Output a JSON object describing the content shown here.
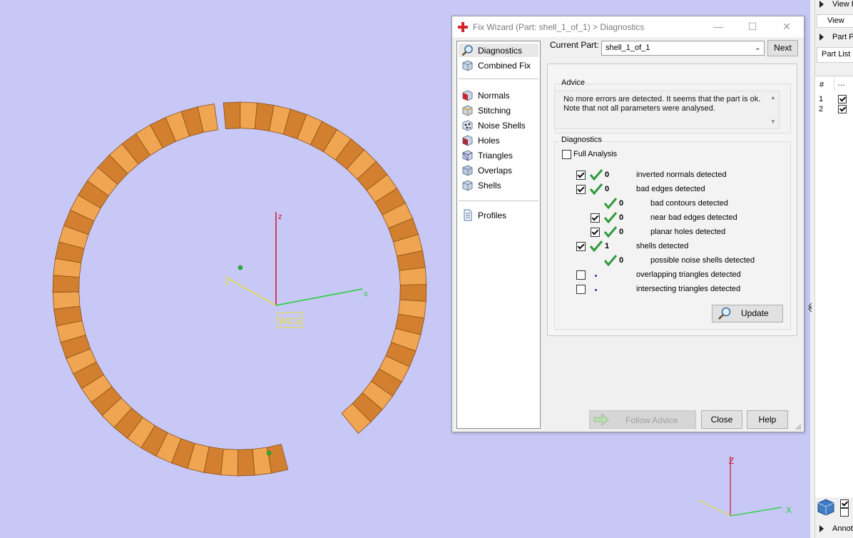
{
  "dialog": {
    "title": "Fix Wizard (Part: shell_1_of_1) > Diagnostics",
    "minimize_icon": "—",
    "maximize_icon": "☐",
    "close_icon": "✕",
    "nav": [
      {
        "label": "Diagnostics",
        "icon": "magnifier-icon",
        "selected": true
      },
      {
        "label": "Combined Fix",
        "icon": "cube-icon"
      },
      {
        "label": "Normals",
        "icon": "normals-cube-icon"
      },
      {
        "label": "Stitching",
        "icon": "stitching-cube-icon"
      },
      {
        "label": "Noise Shells",
        "icon": "noise-shells-icon"
      },
      {
        "label": "Holes",
        "icon": "holes-cube-icon"
      },
      {
        "label": "Triangles",
        "icon": "triangles-cube-icon"
      },
      {
        "label": "Overlaps",
        "icon": "overlaps-cube-icon"
      },
      {
        "label": "Shells",
        "icon": "shells-cube-icon"
      },
      {
        "label": "Profiles",
        "icon": "profile-document-icon"
      }
    ],
    "current_part_label": "Current Part:",
    "current_part_value": "shell_1_of_1",
    "next_label": "Next",
    "advice": {
      "title": "Advice",
      "text_line1": "No more errors are detected. It seems that the part is ok.",
      "text_line2": "Note that not all parameters were analysed."
    },
    "diagnostics": {
      "title": "Diagnostics",
      "full_analysis_label": "Full Analysis",
      "full_analysis_checked": false,
      "rows": [
        {
          "checked": true,
          "count": "0",
          "label": "inverted normals detected"
        },
        {
          "checked": true,
          "count": "0",
          "label": "bad edges detected"
        },
        {
          "count": "0",
          "label": "bad contours detected"
        },
        {
          "checked": true,
          "count": "0",
          "label": "near bad edges detected"
        },
        {
          "checked": true,
          "count": "0",
          "label": "planar holes detected"
        },
        {
          "checked": true,
          "count": "1",
          "label": "shells detected"
        },
        {
          "count": "0",
          "label": "possible noise shells detected"
        },
        {
          "checked": false,
          "count": "",
          "label": "overlapping triangles detected"
        },
        {
          "checked": false,
          "count": "",
          "label": "intersecting triangles detected"
        }
      ]
    },
    "update_label": "Update",
    "follow_advice_label": "Follow Advice",
    "close_label": "Close",
    "help_label": "Help"
  },
  "viewport": {
    "wcs_label": "WCS",
    "axis_z": "z",
    "axis_y": "y",
    "axis_x": "x",
    "mini_axis_z": "Z",
    "mini_axis_x": "X",
    "model_color": "#d2802f",
    "background_color": "#c8c8f7"
  },
  "right_panel": {
    "view_header": "View P",
    "view_tab": "View",
    "part_header": "Part P",
    "part_list_tab": "Part List",
    "col_hash": "#",
    "col_more": "…",
    "rows": [
      {
        "num": "1",
        "checked": true
      },
      {
        "num": "2",
        "checked": true
      }
    ],
    "annot_header": "Annot"
  }
}
